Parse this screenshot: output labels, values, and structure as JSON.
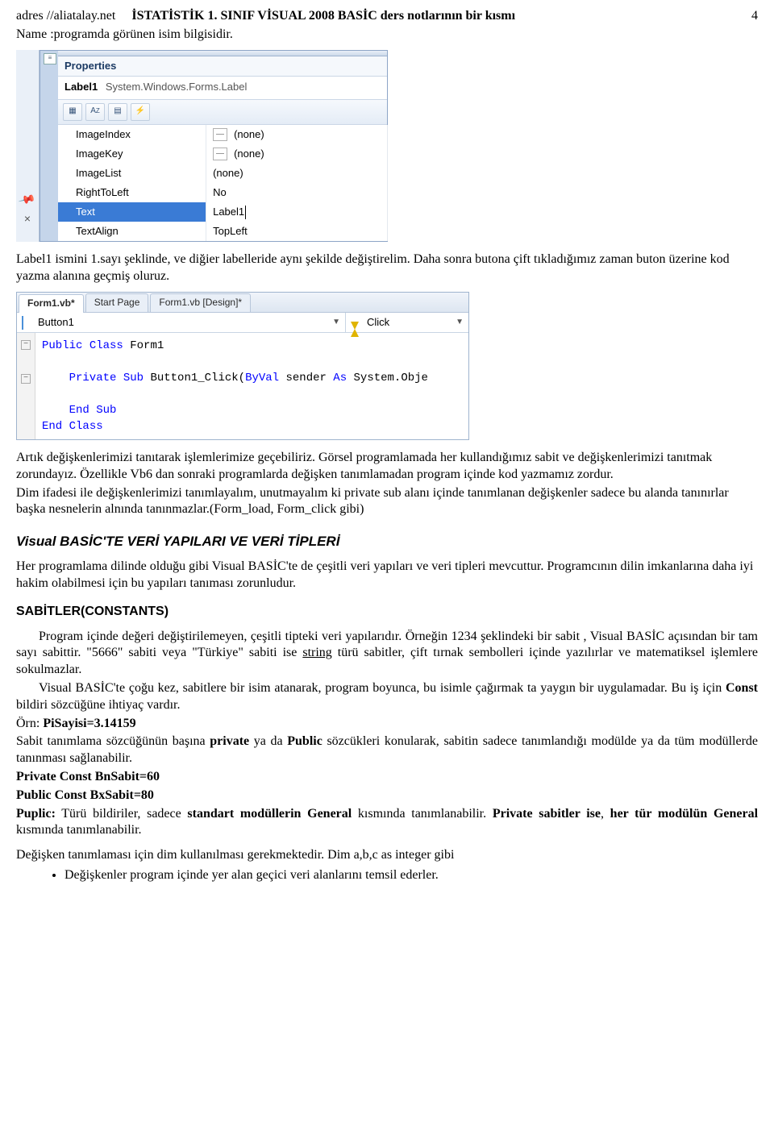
{
  "header": {
    "site": "adres //aliatalay.net",
    "course_title": "İSTATİSTİK 1. SINIF VİSUAL 2008 BASİC ders notlarının bir kısmı",
    "page_number": "4"
  },
  "intro": {
    "line1": "Name :programda görünen isim bilgisidir.",
    "after_img1": "Label1 ismini 1.sayı şeklinde, ve diğier labelleride aynı şekilde değiştirelim. Daha sonra butona çift tıkladığımız zaman buton üzerine kod yazma alanına geçmiş oluruz."
  },
  "props_panel": {
    "title": "Properties",
    "object_name": "Label1",
    "object_type": "System.Windows.Forms.Label",
    "toolbar": [
      "cat-icon",
      "az-icon",
      "prop-icon",
      "events-icon"
    ],
    "rows": [
      {
        "key": "ImageIndex",
        "val": "(none)",
        "box": true
      },
      {
        "key": "ImageKey",
        "val": "(none)",
        "box": true
      },
      {
        "key": "ImageList",
        "val": "(none)"
      },
      {
        "key": "RightToLeft",
        "val": "No"
      },
      {
        "key": "Text",
        "val": "Label1",
        "selected": true,
        "cursor": true
      },
      {
        "key": "TextAlign",
        "val": "TopLeft"
      }
    ]
  },
  "code_panel": {
    "tabs": [
      {
        "label": "Form1.vb*",
        "active": true
      },
      {
        "label": "Start Page"
      },
      {
        "label": "Form1.vb [Design]*"
      }
    ],
    "combo_left": "Button1",
    "combo_right": "Click",
    "lines": [
      {
        "segments": [
          {
            "t": "Public ",
            "c": "kw"
          },
          {
            "t": "Class ",
            "c": "kw"
          },
          {
            "t": "Form1",
            "c": "plain"
          }
        ]
      },
      {
        "segments": []
      },
      {
        "segments": [
          {
            "t": "    Private ",
            "c": "kw"
          },
          {
            "t": "Sub ",
            "c": "kw"
          },
          {
            "t": "Button1_Click(",
            "c": "plain"
          },
          {
            "t": "ByVal ",
            "c": "kw"
          },
          {
            "t": "sender ",
            "c": "plain"
          },
          {
            "t": "As ",
            "c": "kw"
          },
          {
            "t": "System.Obje",
            "c": "plain"
          }
        ]
      },
      {
        "segments": []
      },
      {
        "segments": [
          {
            "t": "    End ",
            "c": "kw"
          },
          {
            "t": "Sub",
            "c": "kw"
          }
        ]
      },
      {
        "segments": [
          {
            "t": "End ",
            "c": "kw"
          },
          {
            "t": "Class",
            "c": "kw"
          }
        ]
      }
    ]
  },
  "body_text": {
    "para_after_code": "Artık değişkenlerimizi tanıtarak işlemlerimize geçebiliriz. Görsel programlamada her kullandığımız sabit ve değişkenlerimizi tanıtmak zorundayız. Özellikle Vb6 dan sonraki programlarda değişken tanımlamadan program içinde kod yazmamız zordur.",
    "para_dim": "Dim ifadesi ile değişkenlerimizi tanımlayalım, unutmayalım ki private sub alanı içinde tanımlanan değişkenler sadece bu alanda tanınırlar başka nesnelerin alnında tanınmazlar.(Form_load, Form_click gibi)",
    "sec_title": "Visual BASİC'TE VERİ YAPILARI VE VERİ TİPLERİ",
    "para_veri": "Her programlama dilinde olduğu gibi Visual BASİC'te de çeşitli veri yapıları ve veri tipleri mevcuttur. Programcının dilin imkanlarına daha iyi hakim olabilmesi için bu yapıları tanıması zorunludur.",
    "sub_title": "SABİTLER(CONSTANTS)",
    "sabit_p1_a": "Program içinde değeri değiştirilemeyen, çeşitli tipteki veri yapılarıdır. Örneğin 1234   şeklindeki   bir   sabit   , Visual BASİC açısından bir tam sayı sabittir. \"5666\" sabiti veya \"Türkiye\" sabiti ise ",
    "sabit_p1_u": "string",
    "sabit_p1_b": "  türü sabitler, çift tırnak sembolleri içinde yazılırlar ve matematiksel işlemlere sokulmazlar.",
    "sabit_p2_a": "Visual BASİC'te çoğu kez, sabitlere bir isim atanarak, program boyunca, bu isimle çağırmak ta yaygın bir uygulamadar. Bu iş için ",
    "sabit_p2_const": "Const",
    "sabit_p2_b": "  bildiri sözcüğüne ihtiyaç vardır.",
    "orn_label": "Örn: ",
    "orn_code": "PiSayisi=3.14159",
    "priv_pub_a": "Sabit tanımlama sözcüğünün başına ",
    "priv": "private",
    "priv_pub_b": " ya da ",
    "pub": "Public",
    "priv_pub_c": " sözcükleri konularak, sabitin sadece tanımlandığı modülde ya da tüm modüllerde tanınması sağlanabilir.",
    "private_const": "Private Const BnSabit=60",
    "public_const": "Public Const BxSabit=80",
    "puplic_a": "Puplic:",
    "puplic_b": " Türü bildiriler, sadece ",
    "puplic_c": "standart modüllerin General",
    "puplic_d": " kısmında tanımlanabilir.  ",
    "puplic_e": "Private sabitler ise",
    "puplic_f": ", ",
    "puplic_g": "her tür modülün General",
    "puplic_h": " kısmında tanımlanabilir.",
    "dim_line": "Değişken tanımlaması için  dim kullanılması gerekmektedir. Dim a,b,c as integer gibi",
    "bullet1": "Değişkenler program içinde yer alan geçici veri alanlarını temsil ederler."
  }
}
